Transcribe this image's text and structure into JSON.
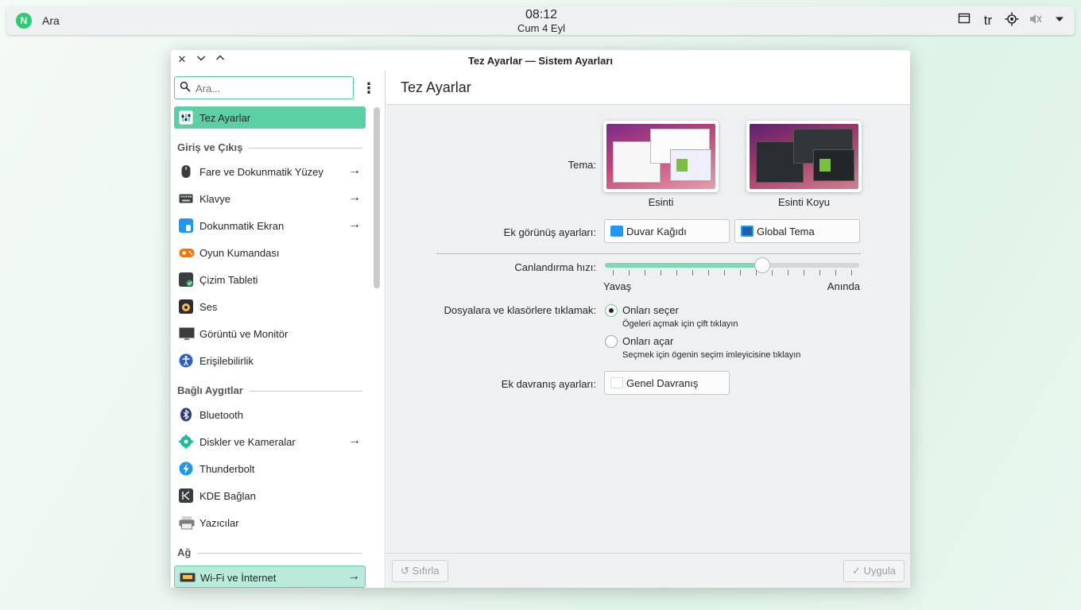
{
  "panel": {
    "search_label": "Ara",
    "time": "08:12",
    "date": "Cum 4 Eyl",
    "lang": "tr",
    "launcher_icon": "n-logo-icon"
  },
  "window": {
    "title": "Tez Ayarlar — Sistem Ayarları"
  },
  "sidebar": {
    "search_placeholder": "Ara...",
    "selected": {
      "label": "Tez Ayarlar"
    },
    "sections": {
      "input": "Giriş ve Çıkış",
      "devices": "Bağlı Aygıtlar",
      "network": "Ağ"
    },
    "items": [
      {
        "label": "Fare ve Dokunmatik Yüzey",
        "icon": "mouse-icon",
        "arrow": true
      },
      {
        "label": "Klavye",
        "icon": "keyboard-icon",
        "arrow": true
      },
      {
        "label": "Dokunmatik Ekran",
        "icon": "touchscreen-icon",
        "arrow": true
      },
      {
        "label": "Oyun Kumandası",
        "icon": "gamepad-icon",
        "arrow": false
      },
      {
        "label": "Çizim Tableti",
        "icon": "tablet-icon",
        "arrow": false
      },
      {
        "label": "Ses",
        "icon": "speaker-icon",
        "arrow": false
      },
      {
        "label": "Görüntü ve Monitör",
        "icon": "monitor-icon",
        "arrow": false
      },
      {
        "label": "Erişilebilirlik",
        "icon": "accessibility-icon",
        "arrow": false
      },
      {
        "label": "Bluetooth",
        "icon": "bluetooth-icon",
        "arrow": false
      },
      {
        "label": "Diskler ve Kameralar",
        "icon": "disks-icon",
        "arrow": true
      },
      {
        "label": "Thunderbolt",
        "icon": "thunderbolt-icon",
        "arrow": false
      },
      {
        "label": "KDE Bağlan",
        "icon": "kdeconnect-icon",
        "arrow": false
      },
      {
        "label": "Yazıcılar",
        "icon": "printer-icon",
        "arrow": false
      },
      {
        "label": "Wi-Fi ve İnternet",
        "icon": "network-icon",
        "arrow": true
      }
    ]
  },
  "main": {
    "header": "Tez Ayarlar",
    "theme_label": "Tema:",
    "themes": [
      {
        "name": "Esinti",
        "variant": "light"
      },
      {
        "name": "Esinti Koyu",
        "variant": "dark"
      }
    ],
    "extra_look_label": "Ek görünüş ayarları:",
    "wallpaper_button": "Duvar Kağıdı",
    "global_theme_button": "Global Tema",
    "animation_label": "Canlandırma hızı:",
    "animation_slow": "Yavaş",
    "animation_fast": "Anında",
    "animation_value": 0.62,
    "click_label": "Dosyalara ve klasörlere tıklamak:",
    "click_options": [
      {
        "title": "Onları seçer",
        "subtitle": "Ögeleri açmak için çift tıklayın",
        "checked": true
      },
      {
        "title": "Onları açar",
        "subtitle": "Seçmek için ögenin seçim imleyicisine tıklayın",
        "checked": false
      }
    ],
    "extra_behavior_label": "Ek davranış ayarları:",
    "general_behavior_button": "Genel Davranış"
  },
  "footer": {
    "reset": "Sıfırla",
    "apply": "Uygula"
  },
  "colors": {
    "accent": "#5cd0a4",
    "accent_light": "#b9eadb"
  }
}
